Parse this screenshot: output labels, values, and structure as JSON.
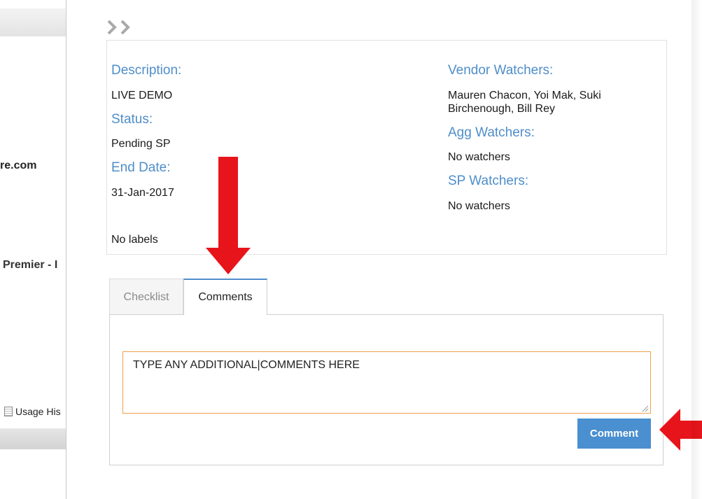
{
  "left_panel": {
    "domain_fragment": "re.com",
    "premier_fragment": "Premier - I",
    "usage_fragment": "Usage His"
  },
  "details": {
    "description_label": "Description:",
    "description_value": "LIVE DEMO",
    "status_label": "Status:",
    "status_value": "Pending SP",
    "end_date_label": "End Date:",
    "end_date_value": "31-Jan-2017",
    "labels_value": "No labels",
    "vendor_watchers_label": "Vendor Watchers:",
    "vendor_watchers_value": "Mauren Chacon, Yoi Mak, Suki Birchenough, Bill Rey",
    "agg_watchers_label": "Agg Watchers:",
    "agg_watchers_value": "No watchers",
    "sp_watchers_label": "SP Watchers:",
    "sp_watchers_value": "No watchers"
  },
  "tabs": [
    {
      "label": "Checklist",
      "active": false
    },
    {
      "label": "Comments",
      "active": true
    }
  ],
  "comments": {
    "input_value": "TYPE ANY ADDITIONAL|COMMENTS HERE",
    "button_label": "Comment"
  },
  "icons": {
    "collapse": "double-chevron-right-icon",
    "usage": "document-icon"
  },
  "colors": {
    "label_blue": "#4f8ec9",
    "button_blue": "#4a8fcf",
    "input_border": "#f0a04b",
    "annotation_red": "#e8141b"
  }
}
